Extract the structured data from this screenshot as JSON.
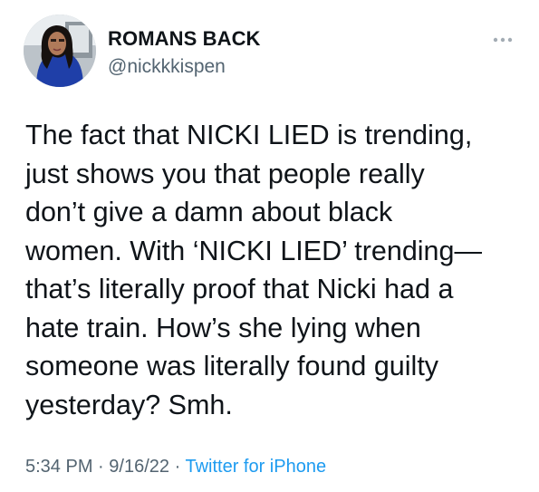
{
  "author": {
    "display_name": "ROMANS BACK",
    "handle": "@nickkkispen"
  },
  "tweet": {
    "lines": [
      "The fact that NICKI LIED is trending,",
      "just shows you that people really",
      "don’t give a damn about black",
      "women. With ‘NICKI LIED’ trending—",
      "that’s literally proof that Nicki had a",
      "hate train. How’s she lying when",
      "someone was literally found guilty",
      "yesterday? Smh."
    ]
  },
  "meta": {
    "time": "5:34 PM",
    "separator": "·",
    "date": "9/16/22",
    "source": "Twitter for iPhone"
  },
  "icons": {
    "more": "more-horizontal-icon",
    "avatar": "profile-photo"
  },
  "colors": {
    "text": "#0f1419",
    "secondary": "#536471",
    "link": "#1d9bf0"
  }
}
